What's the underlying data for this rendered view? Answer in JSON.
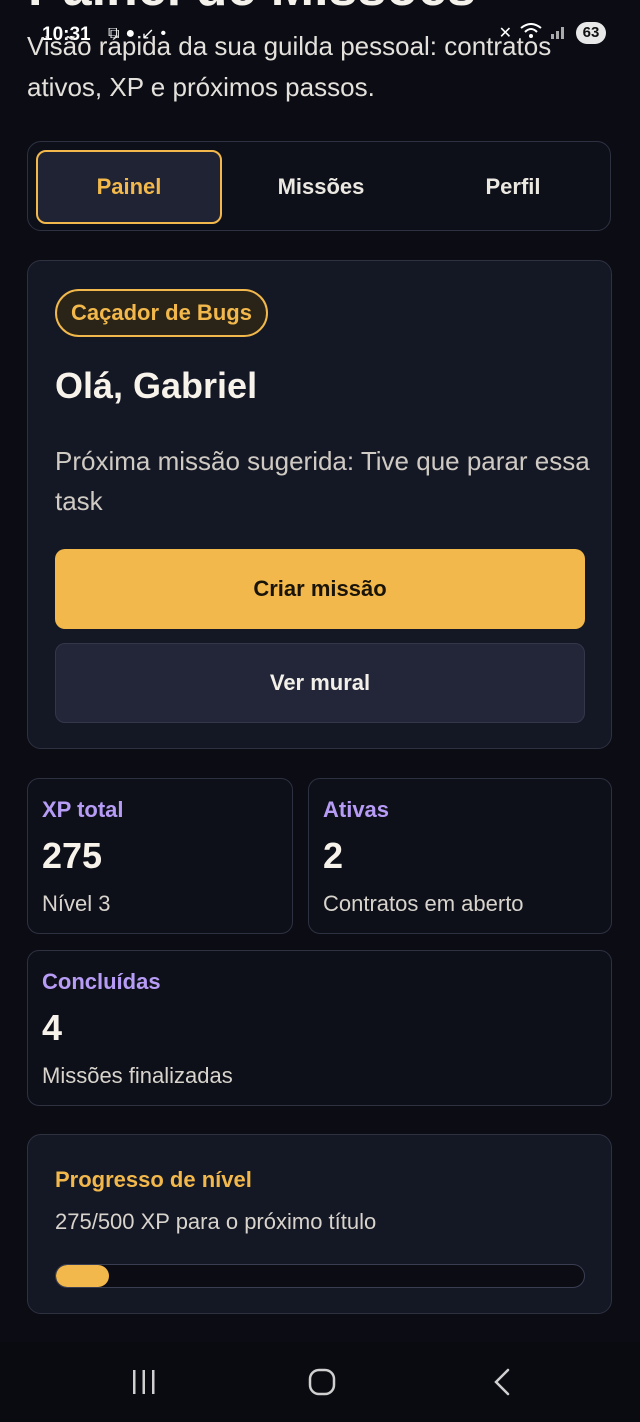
{
  "status_bar": {
    "time": "10:31",
    "battery": "63"
  },
  "header": {
    "title": "Painel de Missões",
    "subtitle": "Visão rápida da sua guilda pessoal: contratos ativos, XP e próximos passos."
  },
  "tabs": [
    {
      "label": "Painel",
      "active": true
    },
    {
      "label": "Missões",
      "active": false
    },
    {
      "label": "Perfil",
      "active": false
    }
  ],
  "hero": {
    "badge": "Caçador de Bugs",
    "greeting": "Olá, Gabriel",
    "suggestion": "Próxima missão sugerida: Tive que parar essa task",
    "primary_button": "Criar missão",
    "secondary_button": "Ver mural"
  },
  "stats": {
    "xp": {
      "label": "XP total",
      "value": "275",
      "note": "Nível 3"
    },
    "active": {
      "label": "Ativas",
      "value": "2",
      "note": "Contratos em aberto"
    },
    "done": {
      "label": "Concluídas",
      "value": "4",
      "note": "Missões finalizadas"
    }
  },
  "progress": {
    "title": "Progresso de nível",
    "text": "275/500 XP para o próximo título",
    "fraction": 0.1
  },
  "colors": {
    "accent": "#f2b84b",
    "label_purple": "#b79cf5",
    "background": "#0b0c14",
    "card": "#141724"
  },
  "navbar": {
    "icons": [
      "recent-apps-icon",
      "home-icon",
      "back-icon"
    ]
  }
}
